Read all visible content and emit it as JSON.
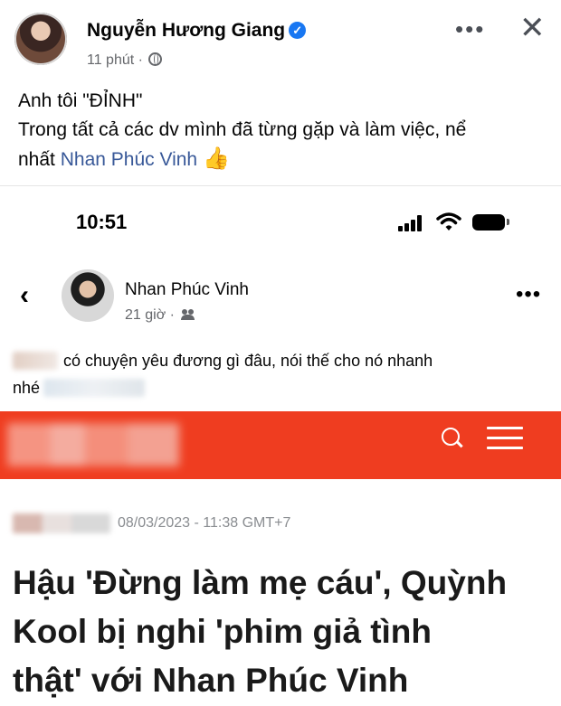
{
  "outer_post": {
    "author": "Nguyễn Hương Giang",
    "time": "11 phút",
    "separator": "·",
    "text_line1": "Anh tôi \"ĐỈNH\"",
    "text_line2": "Trong tất cả các dv mình đã từng gặp và làm việc, nể",
    "text_line3_prefix": "nhất ",
    "tagged_name": "Nhan Phúc Vinh",
    "emoji": "👍",
    "more_icon": "more-horizontal-icon",
    "close_icon": "close-icon"
  },
  "status_bar": {
    "time": "10:51"
  },
  "inner_post": {
    "author": "Nhan Phúc Vinh",
    "time": "21 giờ",
    "separator": "·",
    "text_line1": "có chuyện yêu đương gì đâu, nói thế cho nó nhanh",
    "text_line2": "nhé"
  },
  "article": {
    "date": "08/03/2023 - 11:38 GMT+7",
    "headline_line1": "Hậu 'Đừng làm mẹ cáu', Quỳnh",
    "headline_line2": "Kool bị nghi 'phim giả tình",
    "headline_line3": "thật' với Nhan Phúc Vinh"
  },
  "colors": {
    "brand_red": "#ef3d20",
    "link": "#385898",
    "verified": "#1877f2"
  }
}
